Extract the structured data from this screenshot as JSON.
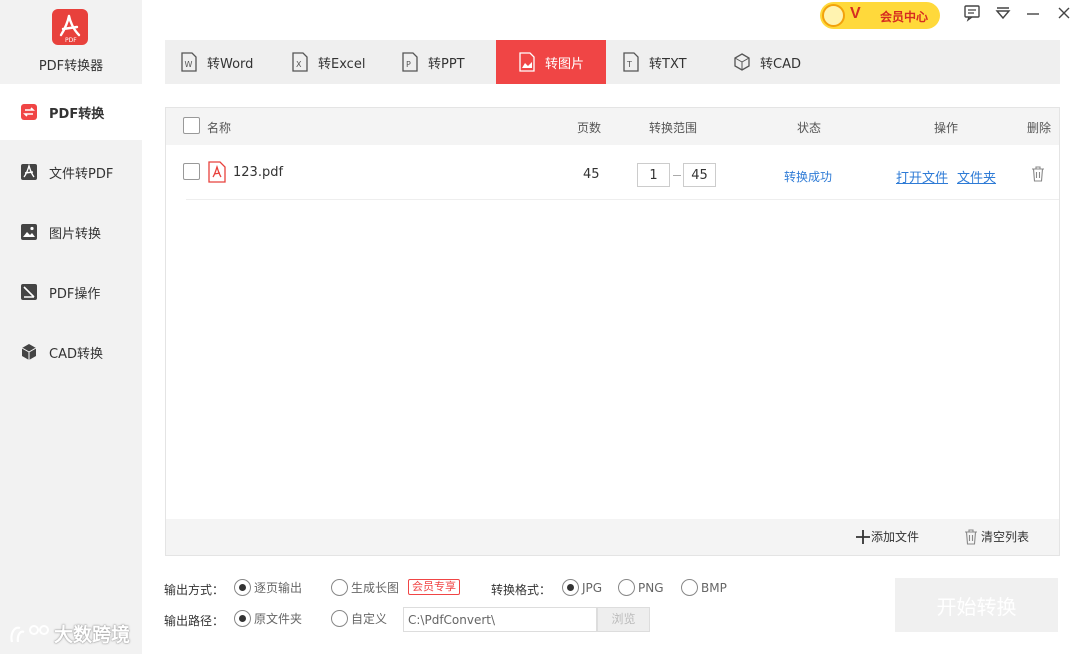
{
  "app": {
    "name": "PDF转换器"
  },
  "sidebar": {
    "items": [
      {
        "label": "PDF转换",
        "icon": "convert-icon",
        "active": true
      },
      {
        "label": "文件转PDF",
        "icon": "pdf-icon",
        "active": false
      },
      {
        "label": "图片转换",
        "icon": "image-icon",
        "active": false
      },
      {
        "label": "PDF操作",
        "icon": "edit-icon",
        "active": false
      },
      {
        "label": "CAD转换",
        "icon": "cube-icon",
        "active": false
      }
    ]
  },
  "header": {
    "vip_letter": "V",
    "vip_label": "会员中心"
  },
  "tabs": [
    {
      "label": "转Word",
      "icon": "word-icon"
    },
    {
      "label": "转Excel",
      "icon": "excel-icon"
    },
    {
      "label": "转PPT",
      "icon": "ppt-icon"
    },
    {
      "label": "转图片",
      "icon": "image-icon",
      "active": true
    },
    {
      "label": "转TXT",
      "icon": "txt-icon"
    },
    {
      "label": "转CAD",
      "icon": "cube-icon"
    }
  ],
  "table": {
    "columns": [
      "名称",
      "页数",
      "转换范围",
      "状态",
      "操作",
      "删除"
    ],
    "rows": [
      {
        "name": "123.pdf",
        "pages": "45",
        "range_from": "1",
        "range_to": "45",
        "status": "转换成功",
        "action_open": "打开文件",
        "action_folder": "文件夹"
      }
    ]
  },
  "panel_footer": {
    "add": "添加文件",
    "clear": "清空列表"
  },
  "options": {
    "output_mode_label": "输出方式：",
    "mode_page": "逐页输出",
    "mode_long": "生成长图",
    "vip_tag": "会员专享",
    "format_label": "转换格式：",
    "formats": [
      "JPG",
      "PNG",
      "BMP"
    ],
    "path_label": "输出路径：",
    "path_original": "原文件夹",
    "path_custom": "自定义",
    "path_value": "C:\\PdfConvert\\",
    "browse": "浏览"
  },
  "start_button": "开始转换",
  "watermark": "大数跨境",
  "colors": {
    "accent": "#f04545",
    "link": "#2e7bd6",
    "vip": "#ffd93b"
  }
}
